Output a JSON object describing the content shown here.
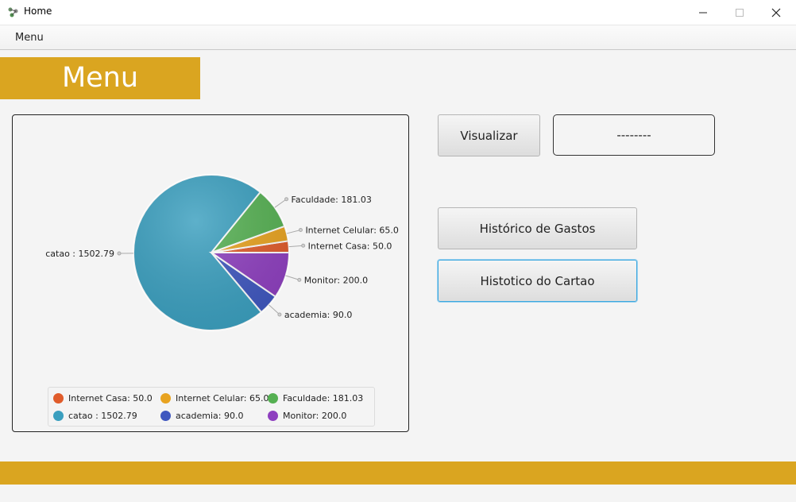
{
  "window": {
    "title": "Home",
    "minimize_icon": "minimize-icon",
    "maximize_icon": "maximize-icon",
    "close_icon": "close-icon"
  },
  "menubar": {
    "menu_label": "Menu"
  },
  "banner": {
    "title": "Menu",
    "color": "#daa520"
  },
  "buttons": {
    "visualizar": "Visualizar",
    "historico_gastos": "Histórico de Gastos",
    "historico_cartao": "Histotico do Cartao"
  },
  "display": {
    "value": "--------"
  },
  "chart_data": {
    "type": "pie",
    "slices": [
      {
        "name": "Internet Casa",
        "value": 50.0,
        "label": "Internet Casa: 50.0",
        "color": "#e05c2b"
      },
      {
        "name": "Internet Celular",
        "value": 65.0,
        "label": "Internet Celular: 65.0",
        "color": "#e8a320"
      },
      {
        "name": "Faculdade",
        "value": 181.03,
        "label": "Faculdade: 181.03",
        "color": "#55b052"
      },
      {
        "name": "catao ",
        "value": 1502.79,
        "label": "catao : 1502.79",
        "color": "#3a9fbf"
      },
      {
        "name": "academia",
        "value": 90.0,
        "label": "academia: 90.0",
        "color": "#3f57bf"
      },
      {
        "name": "Monitor",
        "value": 200.0,
        "label": "Monitor: 200.0",
        "color": "#8e3fbf"
      }
    ],
    "legend_position": "bottom"
  },
  "footer": {
    "color": "#daa520"
  }
}
